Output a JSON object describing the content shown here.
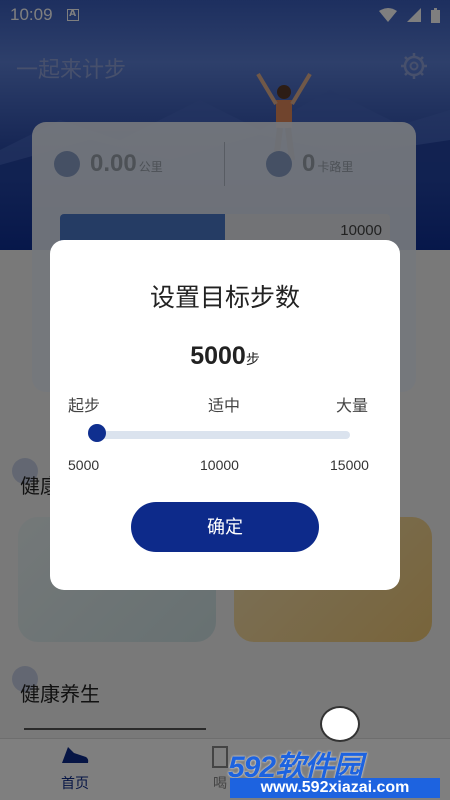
{
  "status_bar": {
    "time": "10:09",
    "notification_glyph": "A"
  },
  "header": {
    "title": "一起来计步"
  },
  "stats": {
    "distance": {
      "value": "0.00",
      "unit": "公里"
    },
    "calories": {
      "value": "0",
      "unit": "卡路里"
    },
    "goal_display": "10000",
    "progress_fraction": 0.5
  },
  "sections": {
    "fitness": "健康",
    "wellness": "健康养生"
  },
  "bottom_nav": {
    "home": "首页",
    "second": "喝"
  },
  "dialog": {
    "title": "设置目标步数",
    "value": "5000",
    "value_unit": "步",
    "levels": [
      "起步",
      "适中",
      "大量"
    ],
    "ticks": [
      "5000",
      "10000",
      "15000"
    ],
    "slider_fraction": 0.0,
    "confirm_label": "确定"
  },
  "watermark": {
    "brand": "592软件园",
    "url": "www.592xiazai.com"
  },
  "colors": {
    "primary": "#0d2a8a",
    "accent": "#1d63e0",
    "track": "#dbe3ee"
  }
}
